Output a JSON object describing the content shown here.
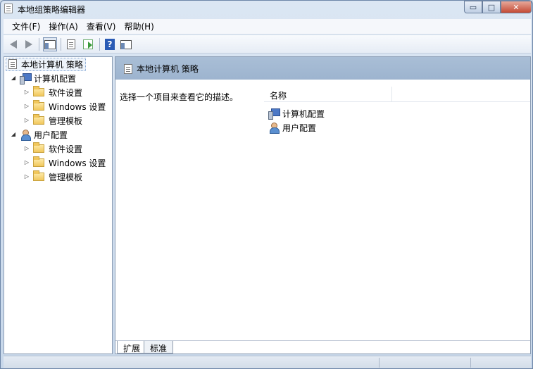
{
  "window": {
    "title": "本地组策略编辑器",
    "buttons": {
      "minimize": "▭",
      "maximize": "□",
      "close": "✕"
    }
  },
  "menubar": {
    "items": [
      "文件(F)",
      "操作(A)",
      "查看(V)",
      "帮助(H)"
    ]
  },
  "toolbar": {
    "icons": [
      "back-icon",
      "forward-icon",
      "show-hide-tree-icon",
      "properties-icon",
      "export-list-icon",
      "help-icon",
      "filter-icon"
    ],
    "help_glyph": "?"
  },
  "tree": {
    "root": "本地计算机 策略",
    "nodes": [
      {
        "label": "计算机配置",
        "icon": "computer-icon",
        "children": [
          "软件设置",
          "Windows 设置",
          "管理模板"
        ]
      },
      {
        "label": "用户配置",
        "icon": "user-icon",
        "children": [
          "软件设置",
          "Windows 设置",
          "管理模板"
        ]
      }
    ]
  },
  "details": {
    "title": "本地计算机 策略",
    "description": "选择一个项目来查看它的描述。",
    "columns": [
      "名称"
    ],
    "rows": [
      {
        "name": "计算机配置",
        "icon": "computer-icon"
      },
      {
        "name": "用户配置",
        "icon": "user-icon"
      }
    ],
    "tabs": [
      "扩展",
      "标准"
    ]
  },
  "colors": {
    "header_band": "#9db4cf",
    "selection_border": "#7fa2d0",
    "folder": "#f1c75c"
  }
}
